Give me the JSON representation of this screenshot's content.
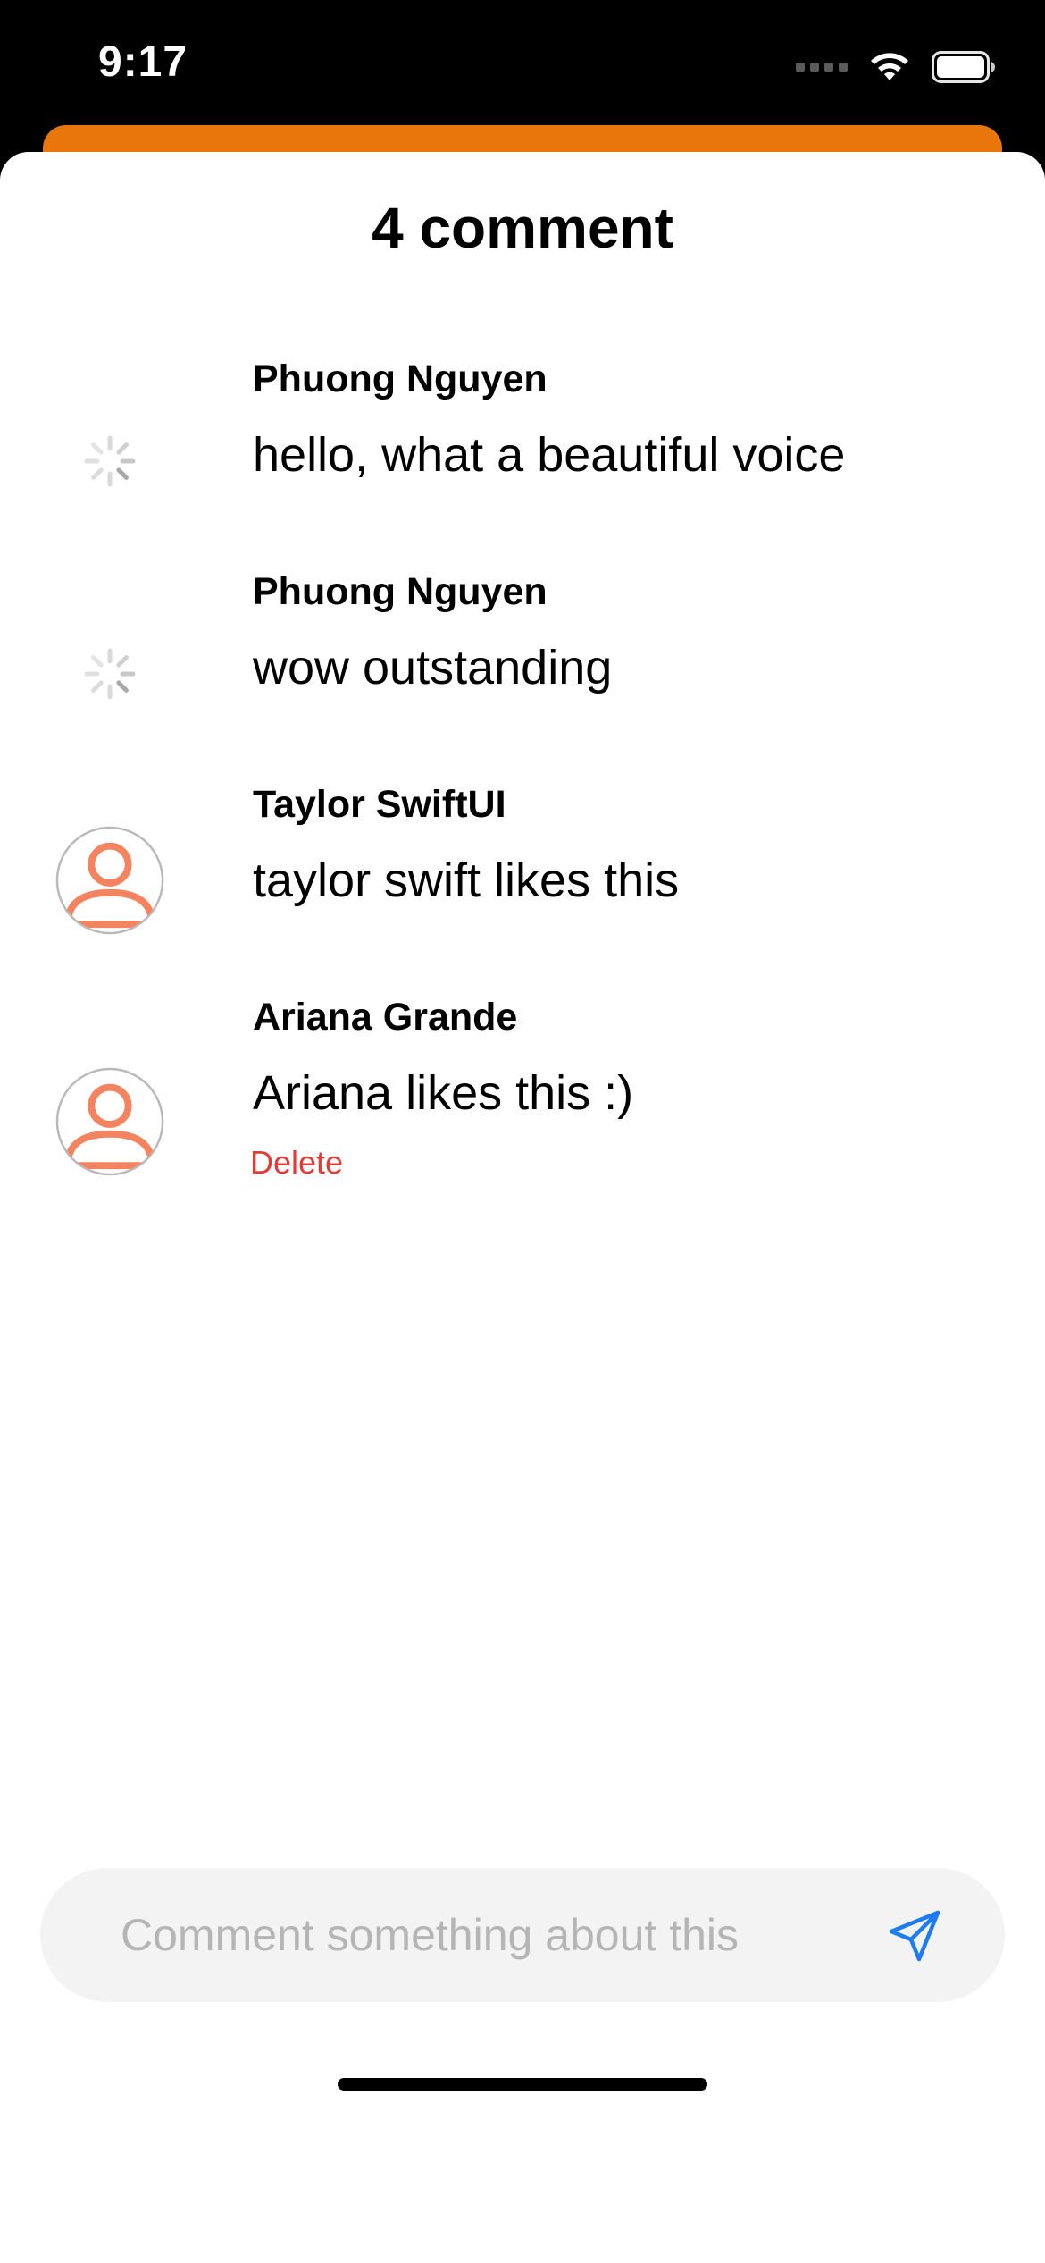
{
  "status_bar": {
    "time": "9:17",
    "icons": [
      "signal-dots-icon",
      "wifi-icon",
      "battery-icon"
    ]
  },
  "colors": {
    "accent_orange": "#E8760A",
    "avatar_orange": "#F4845F",
    "delete_red": "#E53935",
    "send_blue": "#1E7CF2",
    "input_bg": "#F3F3F3"
  },
  "sheet": {
    "title": "4 comment"
  },
  "comments": [
    {
      "author": "Phuong Nguyen",
      "text": "hello, what a beautiful voice",
      "avatar": "loading-spinner-icon"
    },
    {
      "author": "Phuong Nguyen",
      "text": "wow outstanding",
      "avatar": "loading-spinner-icon"
    },
    {
      "author": "Taylor SwiftUI",
      "text": "taylor swift likes this",
      "avatar": "user-avatar-icon"
    },
    {
      "author": "Ariana Grande",
      "text": "Ariana likes this :)",
      "avatar": "user-avatar-icon",
      "action": "Delete"
    }
  ],
  "composer": {
    "placeholder": "Comment something about this",
    "value": "",
    "send_icon": "send-icon"
  }
}
